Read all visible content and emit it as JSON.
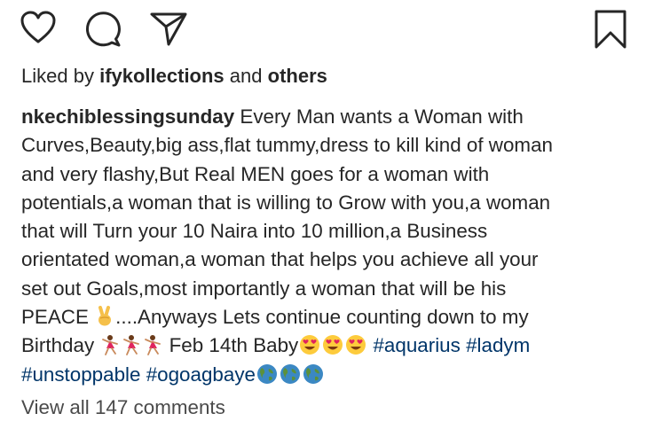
{
  "post": {
    "likes": {
      "prefix": "Liked by",
      "user": "ifykollections",
      "conj": "and",
      "others": "others"
    },
    "caption": {
      "username": "nkechiblessingsunday",
      "line1": "Every Man wants a Woman with",
      "line2": "Curves,Beauty,big ass,flat tummy,dress to kill kind of woman",
      "line3": "and very flashy,But Real MEN goes for a woman with",
      "line4": "potentials,a woman that is willing to Grow with you,a woman",
      "line5": "that will Turn your 10 Naira into 10 million,a Business",
      "line6": "orientated woman,a woman that helps you achieve all your",
      "line7": "set out Goals,most importantly a woman that will be his",
      "line8_a": "PEACE",
      "line8_b": "....Anyways Lets continue counting down to my",
      "line9_a": "Birthday",
      "line9_b": "Feb 14th Baby",
      "hashtag1": "#aquarius",
      "hashtag2": "#ladym",
      "hashtag3": "#unstoppable",
      "hashtag4": "#ogoagbaye"
    },
    "emojis": {
      "peace": "victory-hand",
      "dancer": "dancer",
      "heart_eyes": "heart-eyes-face",
      "globe": "globe"
    },
    "view_comments": "View all 147 comments"
  },
  "colors": {
    "text": "#262626",
    "hashtag": "#003569",
    "muted": "#4a4a4a"
  }
}
